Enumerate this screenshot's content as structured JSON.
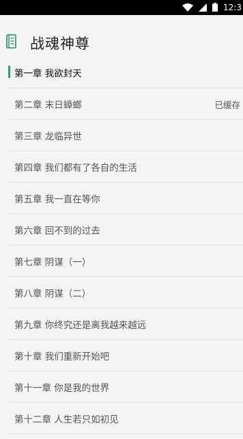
{
  "status_bar": {
    "time": "12:3",
    "wifi_icon": "wifi-icon",
    "signal_icon": "signal-icon",
    "battery_icon": "battery-icon"
  },
  "header": {
    "book_icon": "book-icon",
    "title": "战魂神尊"
  },
  "accent_color": "#3a9b6e",
  "chapters": [
    {
      "title": "第一章 我欲封天",
      "badge": ""
    },
    {
      "title": "第二章 末日蟑螂",
      "badge": "已缓存"
    },
    {
      "title": "第三章 龙临异世",
      "badge": ""
    },
    {
      "title": "第四章 我们都有了各自的生活",
      "badge": ""
    },
    {
      "title": "第五章 我一直在等你",
      "badge": ""
    },
    {
      "title": "第六章 回不到的过去",
      "badge": ""
    },
    {
      "title": "第七章 阴谋（一）",
      "badge": ""
    },
    {
      "title": "第八章 阴谋（二）",
      "badge": ""
    },
    {
      "title": "第九章 你终究还是离我越来越远",
      "badge": ""
    },
    {
      "title": "第十章 我们重新开始吧",
      "badge": ""
    },
    {
      "title": "第十一章 你是我的世界",
      "badge": ""
    },
    {
      "title": "第十二章 人生若只如初见",
      "badge": ""
    }
  ]
}
